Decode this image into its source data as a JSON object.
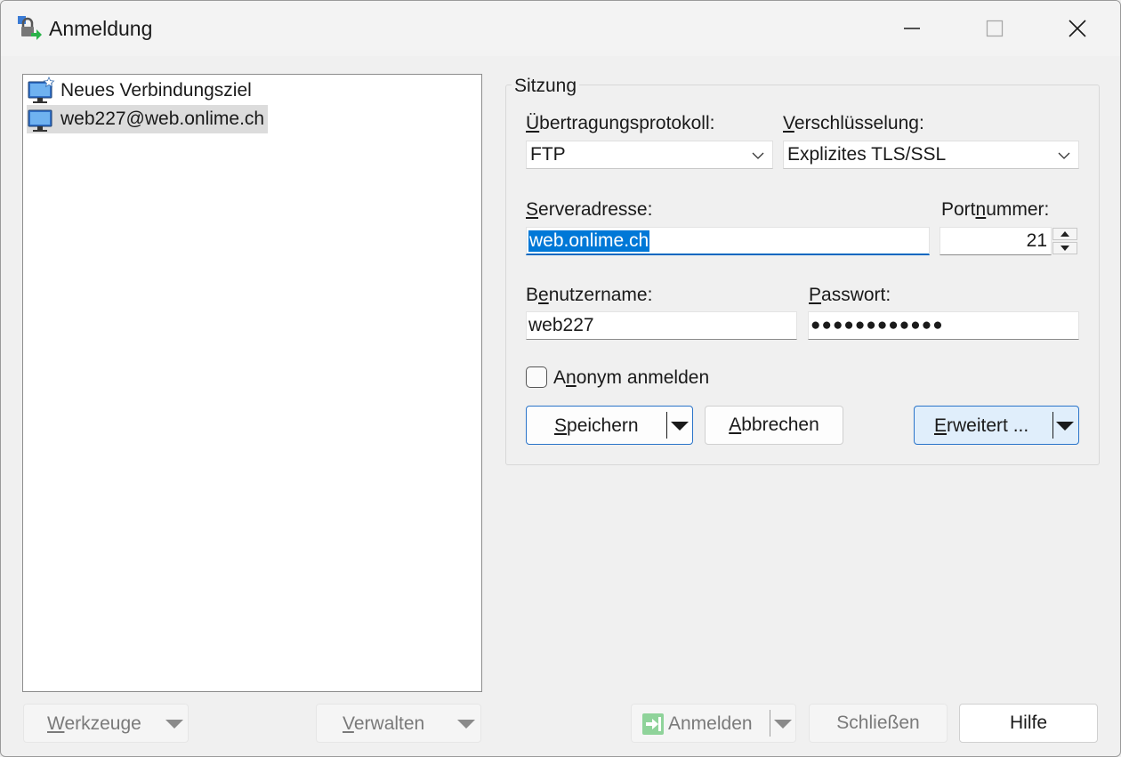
{
  "window": {
    "title": "Anmeldung"
  },
  "tree": {
    "items": [
      {
        "label": "Neues Verbindungsziel",
        "icon": "new-site-monitor-icon"
      },
      {
        "label": "web227@web.onlime.ch",
        "icon": "site-monitor-icon",
        "selected": true
      }
    ]
  },
  "session": {
    "group_title": "Sitzung",
    "protocol_label": "Übertragungsprotokoll:",
    "protocol_value": "FTP",
    "encryption_label": "Verschlüsselung:",
    "encryption_value": "Explizites TLS/SSL",
    "server_label": "Serveradresse:",
    "server_value": "web.onlime.ch",
    "port_label": "Portnummer:",
    "port_value": "21",
    "user_label": "Benutzername:",
    "user_value": "web227",
    "password_label": "Passwort:",
    "password_value": "●●●●●●●●●●●●",
    "anonymous_label": "Anonym anmelden",
    "anonymous_checked": false,
    "save_label": "Speichern",
    "cancel_label": "Abbrechen",
    "advanced_label": "Erweitert ..."
  },
  "footer": {
    "tools_label": "Werkzeuge",
    "manage_label": "Verwalten",
    "login_label": "Anmelden",
    "close_label": "Schließen",
    "help_label": "Hilfe"
  },
  "colors": {
    "accent": "#0067c0",
    "selection": "#0078d7"
  }
}
